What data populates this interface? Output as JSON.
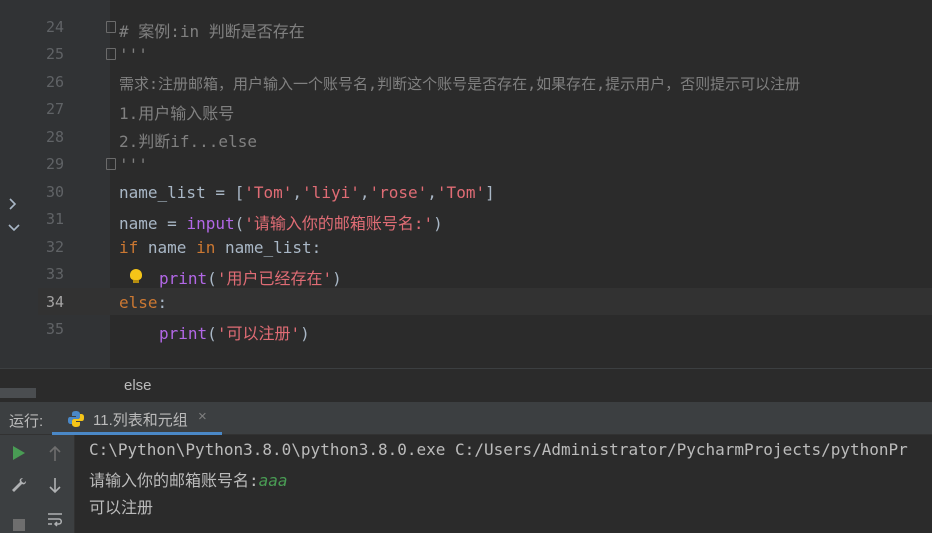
{
  "editor": {
    "line_numbers": [
      "24",
      "25",
      "26",
      "27",
      "28",
      "29",
      "30",
      "31",
      "32",
      "33",
      "34",
      "35"
    ],
    "current_line": "34",
    "lines": {
      "l24": "# 案例:in 判断是否存在",
      "l25": "'''",
      "l26": "需求:注册邮箱，用户输入一个账号名,判断这个账号是否存在,如果存在,提示用户，否则提示可以注册",
      "l27": "1.用户输入账号",
      "l28": "2.判断if...else",
      "l29": "'''",
      "l30_a": "name_list = [",
      "l30_s1": "'Tom'",
      "l30_c1": ",",
      "l30_s2": "'liyi'",
      "l30_c2": ",",
      "l30_s3": "'rose'",
      "l30_c3": ",",
      "l30_s4": "'Tom'",
      "l30_b": "]",
      "l31_a": "name = ",
      "l31_fn": "input",
      "l31_p1": "(",
      "l31_s": "'请输入你的邮箱账号名:'",
      "l31_p2": ")",
      "l32_kw1": "if",
      "l32_mid": " name ",
      "l32_kw2": "in",
      "l32_end": " name_list:",
      "l33_fn": "print",
      "l33_p1": "(",
      "l33_s": "'用户已经存在'",
      "l33_p2": ")",
      "l34_kw": "else",
      "l34_end": ":",
      "l35_fn": "print",
      "l35_p1": "(",
      "l35_s": "'可以注册'",
      "l35_p2": ")"
    }
  },
  "breadcrumb": {
    "text": "else"
  },
  "run_panel": {
    "label": "运行:",
    "tab_title": "11.列表和元组",
    "tab_close": "×",
    "console": {
      "command": "C:\\Python\\Python3.8.0\\python3.8.0.exe C:/Users/Administrator/PycharmProjects/pythonPr",
      "prompt": "请输入你的邮箱账号名:",
      "user_input": "aaa",
      "output": "可以注册"
    }
  },
  "icons": {
    "run": "run-icon",
    "up": "arrow-up-icon",
    "down": "arrow-down-icon",
    "wrench": "wrench-icon",
    "stop": "stop-icon",
    "wrap": "soft-wrap-icon",
    "python": "python-icon",
    "bulb": "lightbulb-icon"
  },
  "colors": {
    "keyword": "#cc7832",
    "string": "#e06c75",
    "function": "#b267e6",
    "comment": "#808080",
    "run_green": "#499c54",
    "tab_underline": "#4a88c7"
  }
}
